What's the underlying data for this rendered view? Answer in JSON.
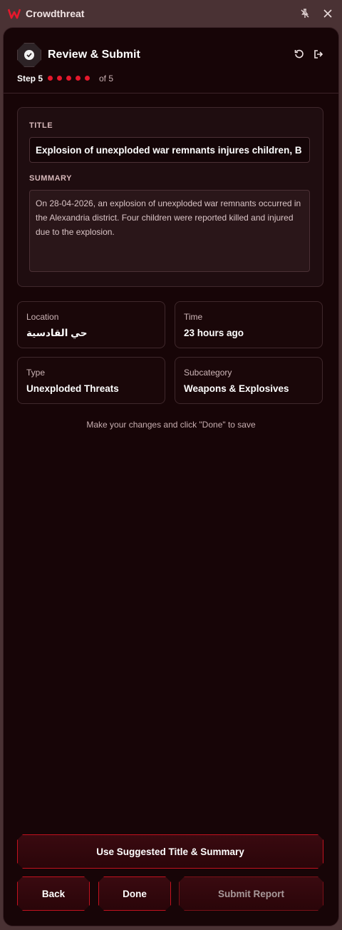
{
  "app": {
    "name": "Crowdthreat"
  },
  "header": {
    "title": "Review & Submit",
    "step_label": "Step 5",
    "step_total_label": "of 5",
    "current_step": 5,
    "total_steps": 5
  },
  "form": {
    "title_label": "TITLE",
    "title_value": "Explosion of unexploded war remnants injures children, B",
    "summary_label": "SUMMARY",
    "summary_value": "On 28-04-2026, an explosion of unexploded war remnants occurred in the Alexandria district. Four children were reported killed and injured due to the explosion."
  },
  "details": {
    "location_label": "Location",
    "location_value": "حي القادسية",
    "time_label": "Time",
    "time_value": "23 hours ago",
    "type_label": "Type",
    "type_value": "Unexploded Threats",
    "subcategory_label": "Subcategory",
    "subcategory_value": "Weapons & Explosives"
  },
  "hint": "Make your changes and click \"Done\" to save",
  "buttons": {
    "suggest": "Use Suggested Title & Summary",
    "back": "Back",
    "done": "Done",
    "submit": "Submit Report"
  },
  "colors": {
    "accent": "#e5182c",
    "panel_bg": "#170507",
    "button_border": "#c2121f"
  }
}
